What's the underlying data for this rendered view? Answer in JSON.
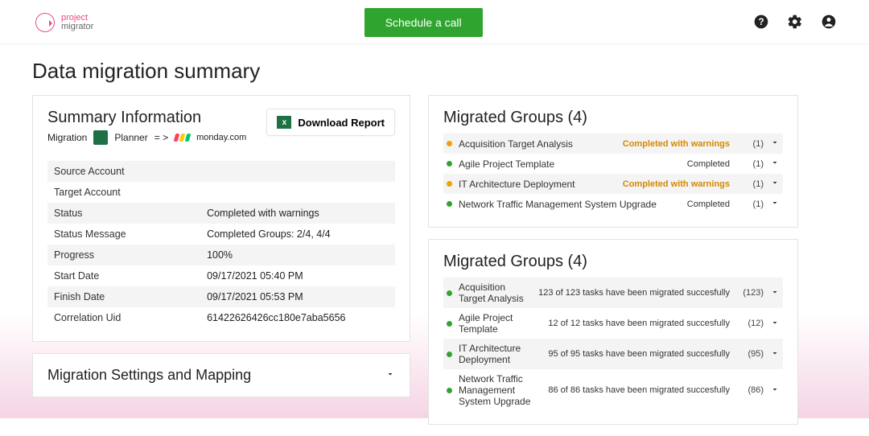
{
  "brand": {
    "line1": "project",
    "line2": "migrator"
  },
  "schedule_label": "Schedule a call",
  "page_title": "Data migration summary",
  "summary": {
    "title": "Summary Information",
    "download_label": "Download Report",
    "migration_label": "Migration",
    "source_name": "Planner",
    "arrow": "= >",
    "target_name": "monday.com",
    "rows": [
      {
        "k": "Source Account",
        "v": ""
      },
      {
        "k": "Target Account",
        "v": ""
      },
      {
        "k": "Status",
        "v": "Completed with warnings"
      },
      {
        "k": "Status Message",
        "v": "Completed Groups: 2/4, 4/4"
      },
      {
        "k": "Progress",
        "v": "100%"
      },
      {
        "k": "Start Date",
        "v": "09/17/2021 05:40 PM"
      },
      {
        "k": "Finish Date",
        "v": "09/17/2021 05:53 PM"
      },
      {
        "k": "Correlation Uid",
        "v": "61422626426cc180e7aba5656"
      }
    ]
  },
  "settings_title": "Migration Settings and Mapping",
  "groups1": {
    "title": "Migrated Groups (4)",
    "items": [
      {
        "dot": "orange",
        "name": "Acquisition Target Analysis",
        "status": "Completed with warnings",
        "warn": true,
        "count": "(1)"
      },
      {
        "dot": "green",
        "name": "Agile Project Template",
        "status": "Completed",
        "warn": false,
        "count": "(1)"
      },
      {
        "dot": "orange",
        "name": "IT Architecture Deployment",
        "status": "Completed with warnings",
        "warn": true,
        "count": "(1)"
      },
      {
        "dot": "green",
        "name": "Network Traffic Management System Upgrade",
        "status": "Completed",
        "warn": false,
        "count": "(1)"
      }
    ]
  },
  "groups2": {
    "title": "Migrated Groups (4)",
    "items": [
      {
        "dot": "green",
        "name": "Acquisition Target Analysis",
        "status": "123 of 123 tasks have been migrated succesfully",
        "warn": false,
        "count": "(123)"
      },
      {
        "dot": "green",
        "name": "Agile Project Template",
        "status": "12 of 12 tasks have been migrated succesfully",
        "warn": false,
        "count": "(12)"
      },
      {
        "dot": "green",
        "name": "IT Architecture Deployment",
        "status": "95 of 95 tasks have been migrated succesfully",
        "warn": false,
        "count": "(95)"
      },
      {
        "dot": "green",
        "name": "Network Traffic Management System Upgrade",
        "status": "86 of 86 tasks have been migrated succesfully",
        "warn": false,
        "count": "(86)"
      }
    ]
  }
}
